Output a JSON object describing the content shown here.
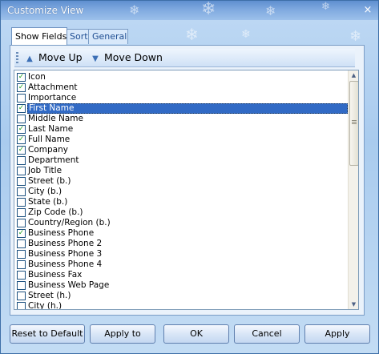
{
  "window": {
    "title": "Customize View",
    "close_glyph": "×"
  },
  "tabs": [
    {
      "label": "Show Fields",
      "active": true
    },
    {
      "label": "Sort",
      "active": false
    },
    {
      "label": "General",
      "active": false
    }
  ],
  "toolbar": {
    "move_up_label": "Move Up",
    "move_down_label": "Move Down",
    "move_up_icon": "arrow-up-icon",
    "move_down_icon": "arrow-down-icon"
  },
  "fields": [
    {
      "label": "Icon",
      "checked": true
    },
    {
      "label": "Attachment",
      "checked": true
    },
    {
      "label": "Importance",
      "checked": false
    },
    {
      "label": "First Name",
      "checked": true,
      "selected": true
    },
    {
      "label": "Middle Name",
      "checked": false
    },
    {
      "label": "Last Name",
      "checked": true
    },
    {
      "label": "Full Name",
      "checked": true
    },
    {
      "label": "Company",
      "checked": true
    },
    {
      "label": "Department",
      "checked": false
    },
    {
      "label": "Job Title",
      "checked": false
    },
    {
      "label": "Street (b.)",
      "checked": false
    },
    {
      "label": "City (b.)",
      "checked": false
    },
    {
      "label": "State (b.)",
      "checked": false
    },
    {
      "label": "Zip Code (b.)",
      "checked": false
    },
    {
      "label": "Country/Region (b.)",
      "checked": false
    },
    {
      "label": "Business Phone",
      "checked": true
    },
    {
      "label": "Business Phone 2",
      "checked": false
    },
    {
      "label": "Business Phone 3",
      "checked": false
    },
    {
      "label": "Business Phone 4",
      "checked": false
    },
    {
      "label": "Business Fax",
      "checked": false
    },
    {
      "label": "Business Web Page",
      "checked": false
    },
    {
      "label": "Street (h.)",
      "checked": false
    },
    {
      "label": "City (h.)",
      "checked": false
    }
  ],
  "buttons": {
    "reset_label": "Reset to Default",
    "apply_to_label": "Apply to",
    "ok_label": "OK",
    "cancel_label": "Cancel",
    "apply_label": "Apply"
  },
  "colors": {
    "selection": "#316ac5",
    "check": "#21a121",
    "titlebar": "#6d9ad6"
  }
}
